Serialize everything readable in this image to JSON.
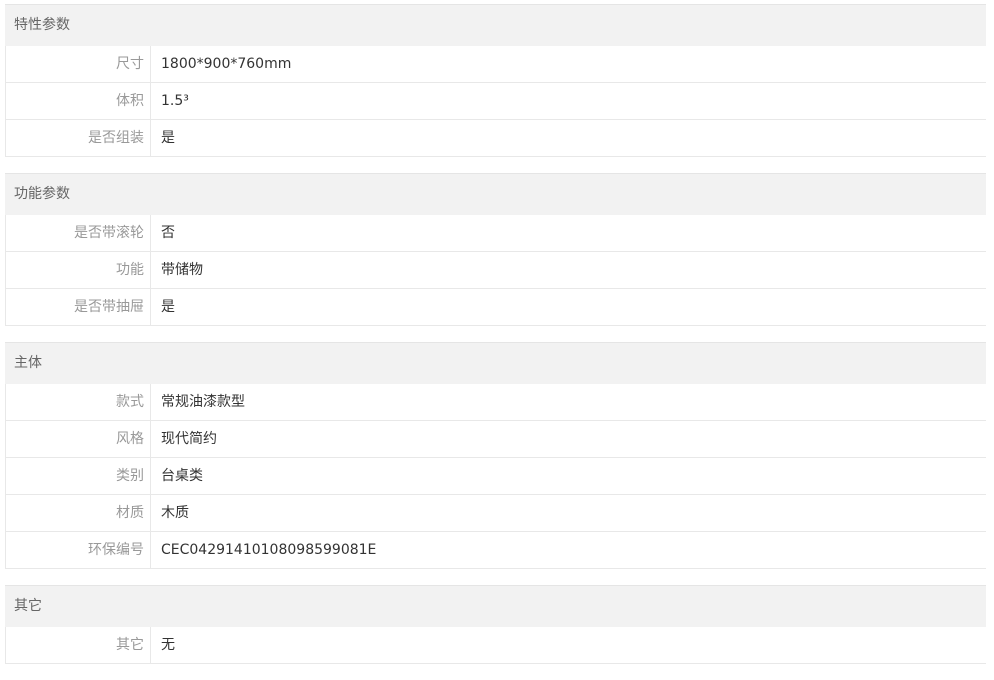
{
  "groups": [
    {
      "title": "特性参数",
      "rows": [
        {
          "label": "尺寸",
          "value": "1800*900*760mm"
        },
        {
          "label": "体积",
          "value": "1.5³"
        },
        {
          "label": "是否组装",
          "value": "是"
        }
      ]
    },
    {
      "title": "功能参数",
      "rows": [
        {
          "label": "是否带滚轮",
          "value": "否"
        },
        {
          "label": "功能",
          "value": "带储物"
        },
        {
          "label": "是否带抽屉",
          "value": "是"
        }
      ]
    },
    {
      "title": "主体",
      "rows": [
        {
          "label": "款式",
          "value": "常规油漆款型"
        },
        {
          "label": "风格",
          "value": "现代简约"
        },
        {
          "label": "类别",
          "value": "台桌类"
        },
        {
          "label": "材质",
          "value": "木质"
        },
        {
          "label": "环保编号",
          "value": "CEC04291410108098599081E"
        }
      ]
    },
    {
      "title": "其它",
      "rows": [
        {
          "label": "其它",
          "value": "无"
        }
      ]
    }
  ]
}
